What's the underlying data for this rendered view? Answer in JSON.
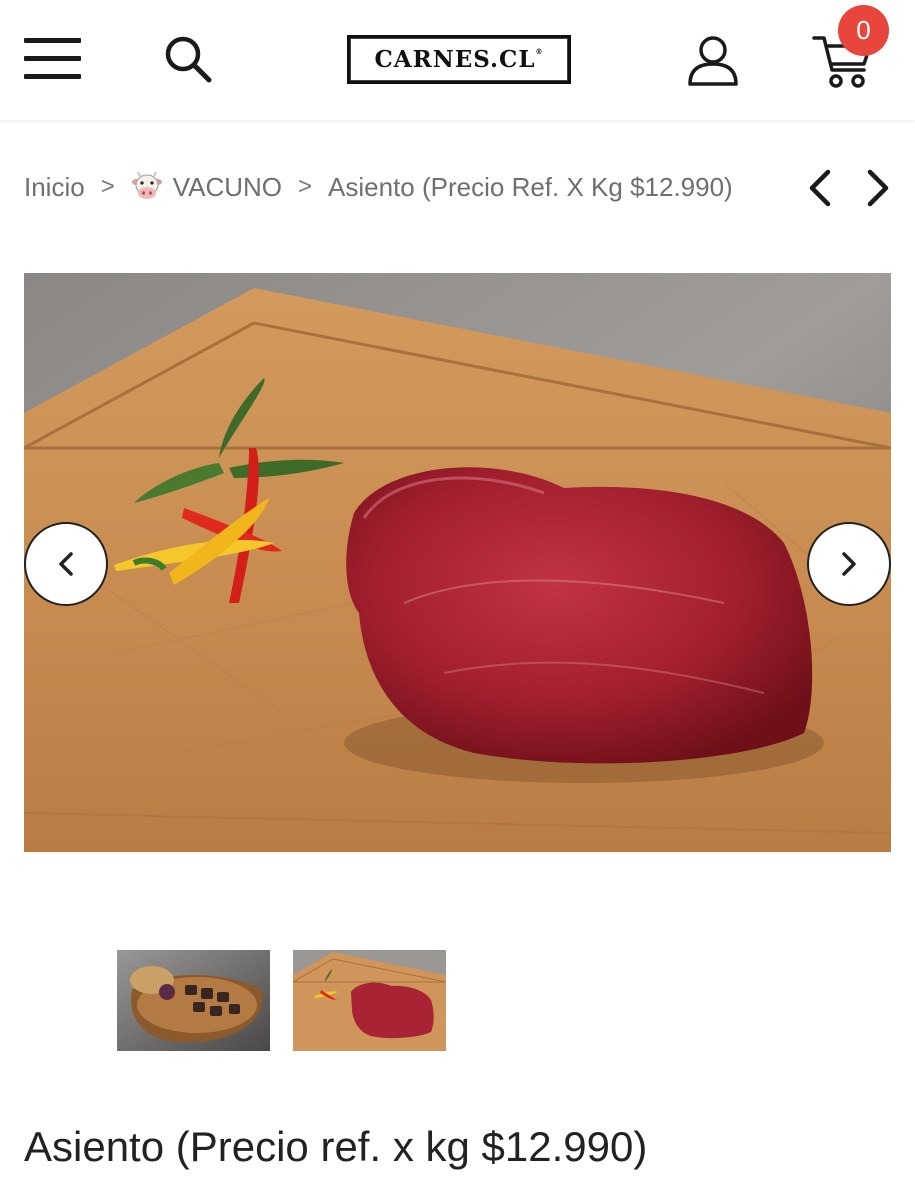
{
  "header": {
    "logo_text": "CARNES.CL",
    "logo_mark": "®",
    "cart_count": "0",
    "icons": [
      "menu-icon",
      "search-icon",
      "user-icon",
      "cart-icon"
    ],
    "badge_color": "#e8453c"
  },
  "breadcrumb": {
    "home": "Inicio",
    "category": "VACUNO",
    "category_icon": "cow-face-icon",
    "current": "Asiento (Precio Ref. X Kg $12.990)",
    "separator": ">"
  },
  "gallery": {
    "active_index": 1,
    "thumbnail_count": 2
  },
  "product": {
    "title": "Asiento (Precio ref. x kg $12.990)"
  }
}
